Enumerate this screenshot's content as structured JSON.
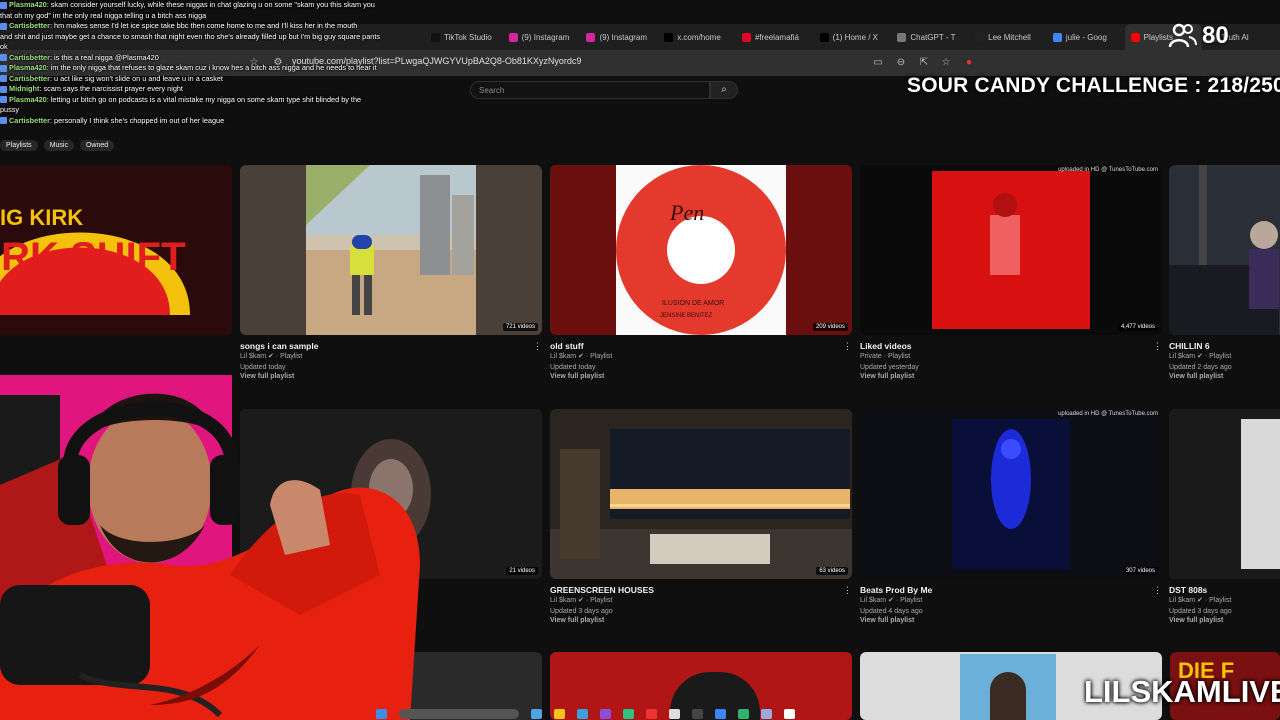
{
  "browser": {
    "url": "youtube.com/playlist?list=PLwgaQJWGYVUpBA2Q8-Ob81KXyzNyordc9",
    "tabs": [
      {
        "label": "TikTok Studio",
        "color": "#111111"
      },
      {
        "label": "(9) Instagram",
        "color": "#d6249f"
      },
      {
        "label": "(9) Instagram",
        "color": "#d6249f"
      },
      {
        "label": "x.com/home",
        "color": "#000000"
      },
      {
        "label": "#freelamafiá",
        "color": "#e60023"
      },
      {
        "label": "(1) Home / X",
        "color": "#000000"
      },
      {
        "label": "ChatGPT - T",
        "color": "#777777"
      },
      {
        "label": "Lee Mitchell",
        "color": "#222222"
      },
      {
        "label": "julie - Goog",
        "color": "#4285f4"
      },
      {
        "label": "Playlists",
        "color": "#ff0000"
      },
      {
        "label": "Truth Al",
        "color": "#444444"
      }
    ]
  },
  "youtube": {
    "search_placeholder": "Search",
    "page_title": "Playlists",
    "chips": [
      "Playlists",
      "Music",
      "Owned"
    ]
  },
  "playlists": [
    {
      "title": "",
      "meta": "",
      "updated": "",
      "link": "",
      "count": "",
      "art": "shell"
    },
    {
      "title": "songs i can sample",
      "meta": "Lil $kam ✔ · Playlist",
      "updated": "Updated today",
      "link": "View full playlist",
      "count": "721 videos",
      "art": "beach"
    },
    {
      "title": "old stuff",
      "meta": "Lil $kam ✔ · Playlist",
      "updated": "Updated today",
      "link": "View full playlist",
      "count": "209 videos",
      "art": "record"
    },
    {
      "title": "Liked videos",
      "meta": "Private · Playlist",
      "updated": "Updated yesterday",
      "link": "View full playlist",
      "count": "4,477 videos",
      "art": "red",
      "uploaded": "uploaded in HD @ TunesToTube.com"
    },
    {
      "title": "CHILLIN 6",
      "meta": "Lil $kam ✔ · Playlist",
      "updated": "Updated 2 days ago",
      "link": "View full playlist",
      "count": "",
      "art": "street"
    },
    {
      "title": "",
      "meta": "",
      "updated": "",
      "link": "",
      "count": "",
      "art": "pink"
    },
    {
      "title": "",
      "meta": "",
      "updated": "",
      "link": "",
      "count": "21 videos",
      "art": "dark"
    },
    {
      "title": "GREENSCREEN HOUSES",
      "meta": "Lil $kam ✔ · Playlist",
      "updated": "Updated 3 days ago",
      "link": "View full playlist",
      "count": "63 videos",
      "art": "house"
    },
    {
      "title": "Beats Prod By Me",
      "meta": "Lil $kam ✔ · Playlist",
      "updated": "Updated 4 days ago",
      "link": "View full playlist",
      "count": "307 videos",
      "art": "blue",
      "uploaded": "uploaded in HD @ TunesToTube.com"
    },
    {
      "title": "DST 808s",
      "meta": "Lil $kam ✔ · Playlist",
      "updated": "Updated 3 days ago",
      "link": "View full playlist",
      "count": "",
      "art": "gray"
    }
  ],
  "chat": [
    {
      "user": "Plasma420",
      "text": ": skam consider yourself lucky, while these niggas in chat glazing u on some \"skam you this skam you"
    },
    {
      "user": "",
      "text": "that oh my god\" im the only real nigga telling u a bitch ass nigga"
    },
    {
      "user": "Cartisbetter",
      "text": ": hm makes sense I'd let ice spice take bbc then come home to me and I'll kiss her in the mouth"
    },
    {
      "user": "",
      "text": "and shit and just maybe get a chance to smash that night even tho she's already filled up but I'm big guy square pants"
    },
    {
      "user": "",
      "text": "ok"
    },
    {
      "user": "Cartisbetter",
      "text": ": is this a real nigga @Plasma420"
    },
    {
      "user": "Plasma420",
      "text": ": im the only nigga that refuses to glaze skam cuz i know hes a bitch ass nigga and he needs to hear it"
    },
    {
      "user": "Cartisbetter",
      "text": ": u act like sig won't slide on u and leave u in a casket"
    },
    {
      "user": "Midnight",
      "text": ": scam says the narcissist prayer every night"
    },
    {
      "user": "Plasma420",
      "text": ": letting ur bitch go on podcasts is a vital mistake my nigga on some skam type shit blinded by the"
    },
    {
      "user": "",
      "text": "pussy"
    },
    {
      "user": "Cartisbetter",
      "text": ": personally I think she's chopped im out of her league"
    }
  ],
  "overlay": {
    "viewers": "80",
    "challenge": "SOUR CANDY CHALLENGE : 218/250",
    "brand": "LILSKAMLIVE"
  },
  "colors": {
    "accent": "#ff0000",
    "bg": "#0f0f0f"
  }
}
